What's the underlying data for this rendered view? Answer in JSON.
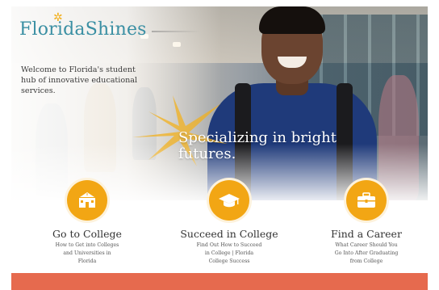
{
  "brand": {
    "logo_text": "FloridaShines",
    "logo_star": "✲"
  },
  "hero": {
    "welcome_text": "Welcome to Florida's student hub of innovative educational services.",
    "tagline_line1": "Specializing in bright",
    "tagline_line2": "futures."
  },
  "features": [
    {
      "title": "Go to College",
      "icon": "school-building-icon",
      "desc": [
        "How to Get into Colleges",
        "and Universities in",
        "Florida"
      ]
    },
    {
      "title": "Succeed in College",
      "icon": "graduation-cap-icon",
      "desc": [
        "Find Out How to Succeed",
        "in College | Florida",
        "College Success"
      ]
    },
    {
      "title": "Find a Career",
      "icon": "briefcase-icon",
      "desc": [
        "What Career Should You",
        "Go Into After Graduating",
        "from College"
      ]
    }
  ],
  "colors": {
    "accent_orange": "#f2a614",
    "brand_teal": "#3a8fa3",
    "footer_coral": "#e66a4e",
    "shirt_navy": "#1f3a7a"
  }
}
